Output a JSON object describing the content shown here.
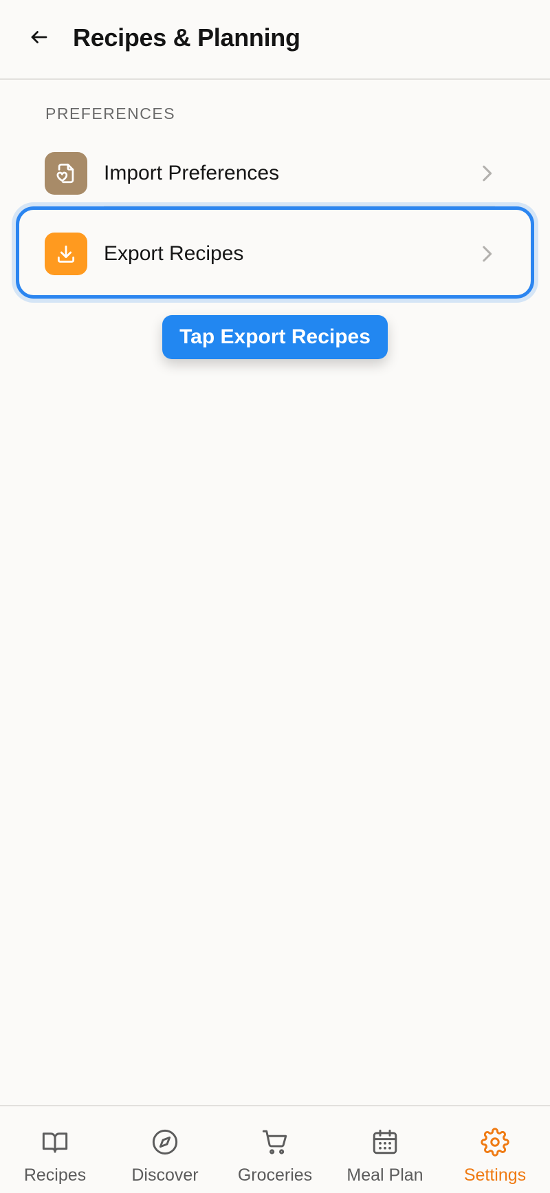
{
  "header": {
    "back_icon": "arrow-left-icon",
    "title": "Recipes & Planning"
  },
  "section": {
    "label": "PREFERENCES"
  },
  "rows": [
    {
      "label": "Import Preferences",
      "icon": "file-heart-icon",
      "icon_color": "#a88b68"
    },
    {
      "label": "Export Recipes",
      "icon": "download-icon",
      "icon_color": "#ff9a1f",
      "highlighted": true
    }
  ],
  "tooltip": {
    "text": "Tap Export Recipes"
  },
  "bottom_nav": {
    "items": [
      {
        "label": "Recipes",
        "icon": "book-open-icon"
      },
      {
        "label": "Discover",
        "icon": "compass-icon"
      },
      {
        "label": "Groceries",
        "icon": "cart-icon"
      },
      {
        "label": "Meal Plan",
        "icon": "calendar-icon"
      },
      {
        "label": "Settings",
        "icon": "gear-icon",
        "active": true
      }
    ]
  },
  "colors": {
    "accent_active": "#ef7a12",
    "highlight": "#2b85f0",
    "tooltip_bg": "#2287f1",
    "background": "#fbfaf8"
  }
}
